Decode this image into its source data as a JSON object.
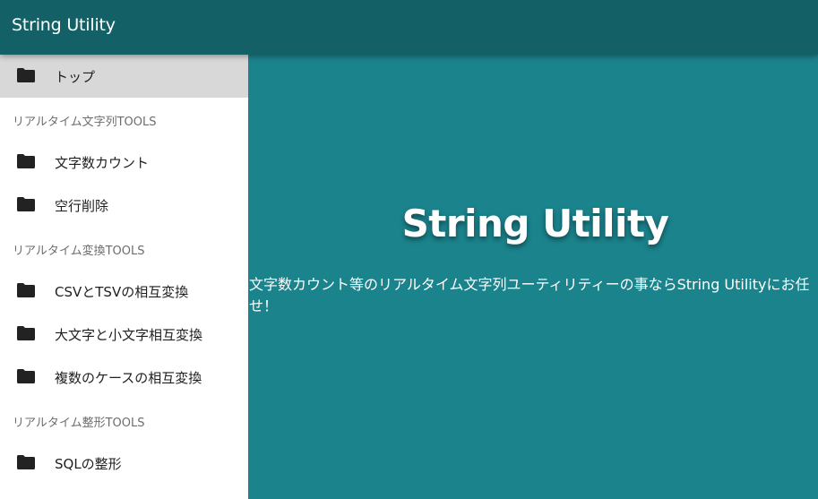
{
  "app": {
    "title": "String Utility"
  },
  "drawer": {
    "top_item": {
      "label": "トップ",
      "icon": "folder-icon"
    },
    "sections": [
      {
        "header": "リアルタイム文字列TOOLS",
        "items": [
          {
            "label": "文字数カウント",
            "icon": "folder-icon"
          },
          {
            "label": "空行削除",
            "icon": "folder-icon"
          }
        ]
      },
      {
        "header": "リアルタイム変換TOOLS",
        "items": [
          {
            "label": "CSVとTSVの相互変換",
            "icon": "folder-icon"
          },
          {
            "label": "大文字と小文字相互変換",
            "icon": "folder-icon"
          },
          {
            "label": "複数のケースの相互変換",
            "icon": "folder-icon"
          }
        ]
      },
      {
        "header": "リアルタイム整形TOOLS",
        "items": [
          {
            "label": "SQLの整形",
            "icon": "folder-icon"
          }
        ]
      }
    ]
  },
  "main": {
    "hero_title": "String Utility",
    "hero_text": "文字数カウント等のリアルタイム文字列ユーティリティーの事ならString Utilityにお任せ！"
  },
  "colors": {
    "appbar": "#136166",
    "main_background": "#1b838c",
    "drawer_background": "#ffffff",
    "active_item_background": "#d8d8d8"
  }
}
